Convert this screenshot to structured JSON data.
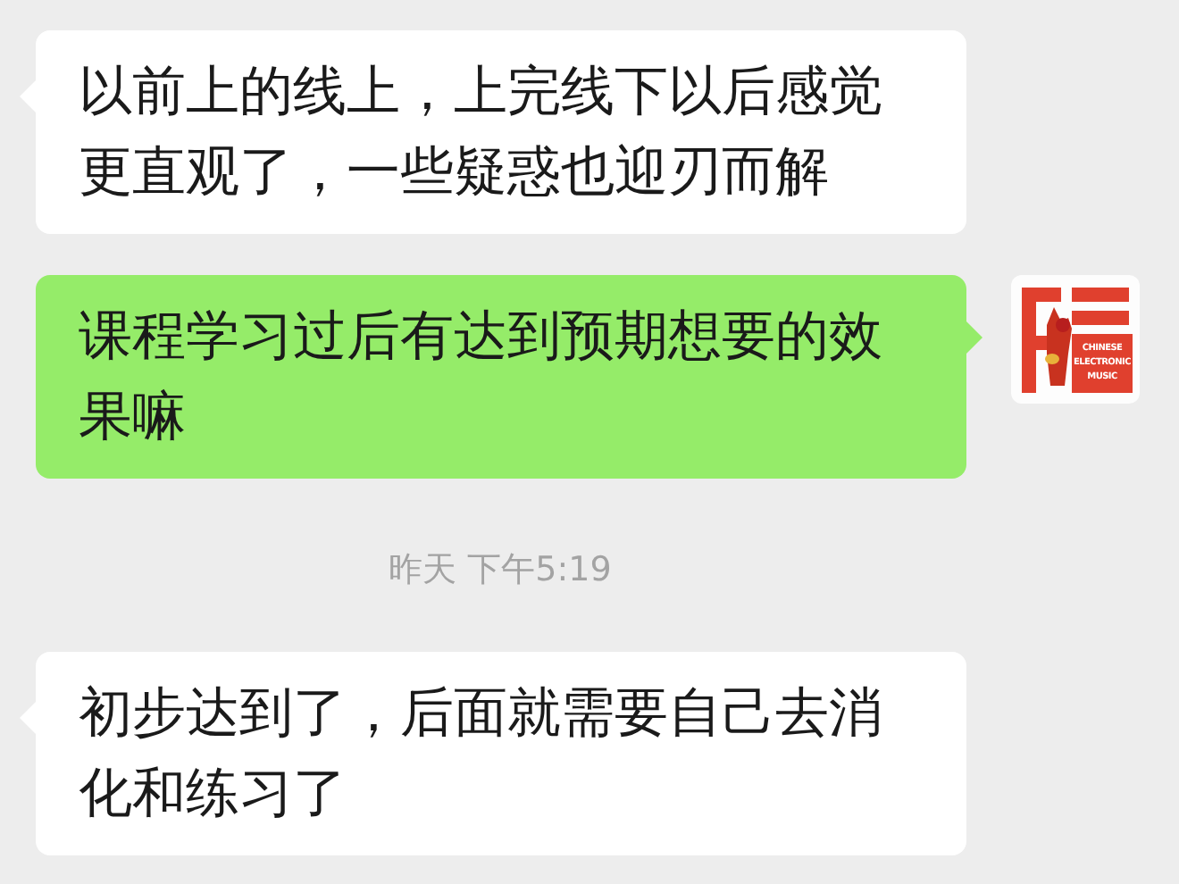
{
  "messages": [
    {
      "kind": "received",
      "text": "以前上的线上，上完线下以后感觉更直观了，一些疑惑也迎刃而解"
    },
    {
      "kind": "sent",
      "text": "课程学习过后有达到预期想要的效果嘛",
      "avatar": {
        "logo_lines": [
          "CHINESE",
          "ELECTRONIC",
          "MUSIC"
        ]
      }
    },
    {
      "kind": "time",
      "text": "昨天 下午5:19"
    },
    {
      "kind": "received",
      "text": "初步达到了，后面就需要自己去消化和练习了"
    }
  ]
}
